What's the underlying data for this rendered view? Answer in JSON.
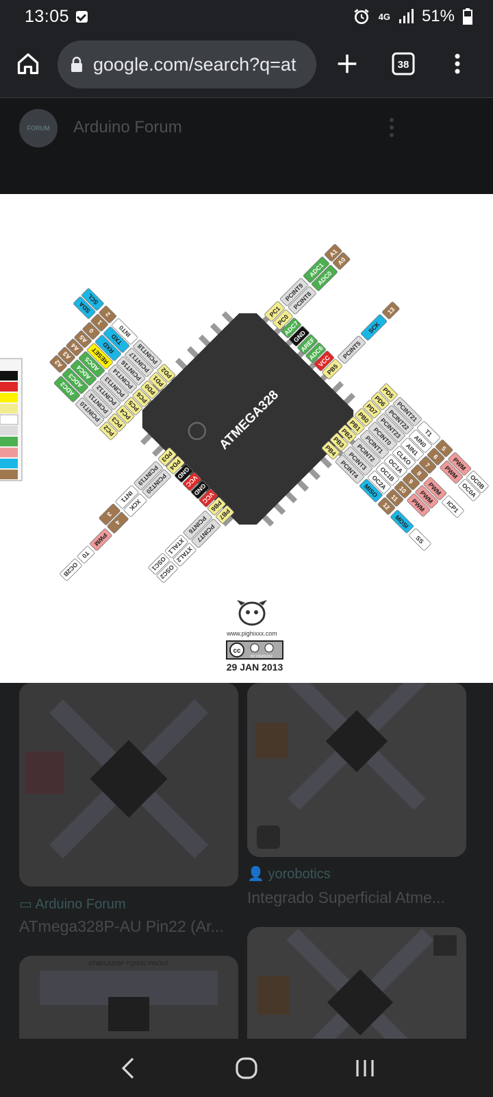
{
  "status_bar": {
    "time": "13:05",
    "network": "4G",
    "battery": "51%"
  },
  "browser": {
    "url": "google.com/search?q=at",
    "tab_count": "38",
    "icons": [
      "home-icon",
      "lock-icon",
      "plus-icon",
      "tabs-icon",
      "more-vert-icon"
    ]
  },
  "viewer": {
    "source_name": "Arduino Forum",
    "avatar_text": "FORUM",
    "diagram": {
      "chip_label": "ATMEGA328",
      "site": "www.pighixxx.com",
      "license": "BY PIGHIXXX",
      "date": "29 JAN 2013",
      "pins_top_left": [
        "PD2",
        "PD1",
        "PD0",
        "PC6",
        "PC5",
        "PC4",
        "PC3",
        "PC2"
      ],
      "labels_top_left_1": [
        "PCINT18",
        "PCINT17",
        "PCINT16",
        "PCINT14",
        "PCINT13",
        "PCINT12",
        "PCINT11",
        "PCINT10"
      ],
      "labels_top_left_2": [
        "INT0",
        "TXD",
        "RXD",
        "RESET",
        "ADC5",
        "ADC4",
        "ADC3",
        "ADC2"
      ],
      "labels_top_left_3": [
        "2",
        "1",
        "0",
        "A5",
        "A4",
        "A3",
        "A2"
      ],
      "labels_top_left_4": [
        "SCL",
        "SDA"
      ],
      "pins_top_right": [
        "PC1",
        "PC0",
        "ADC7",
        "GND",
        "AREF",
        "ADC6",
        "VCC",
        "PB5"
      ],
      "labels_top_right_1": [
        "PCINT9",
        "PCINT8",
        "PCINT5"
      ],
      "labels_top_right_2": [
        "ADC1",
        "ADC0",
        "SCK"
      ],
      "labels_top_right_3": [
        "A1",
        "A0",
        "13"
      ],
      "pins_bottom_left": [
        "PD3",
        "PD4",
        "GND",
        "VCC",
        "GND",
        "VCC",
        "PB6",
        "PB7"
      ],
      "labels_bottom_left_1": [
        "PCINT19",
        "PCINT20",
        "PCINT6",
        "PCINT7"
      ],
      "labels_bottom_left_2": [
        "INT1",
        "XCK",
        "XTAL1",
        "XTAL2"
      ],
      "labels_bottom_left_3": [
        "3",
        "4",
        "OSC1",
        "OSC2"
      ],
      "labels_bottom_left_4": [
        "PWM",
        "T0",
        "OC2B"
      ],
      "pins_bottom_right": [
        "PB4",
        "PB3",
        "PB2",
        "PB1",
        "PB0",
        "PD7",
        "PD6",
        "PD5"
      ],
      "labels_bottom_right_1": [
        "PCINT4",
        "PCINT3",
        "PCINT2",
        "PCINT1",
        "PCINT0",
        "PCINT23",
        "PCINT22",
        "PCINT21"
      ],
      "labels_bottom_right_2": [
        "MISO",
        "OC2A",
        "OC1B",
        "OC1A",
        "CLKO",
        "AIN1",
        "AIN0",
        "T1"
      ],
      "labels_bottom_right_3": [
        "12",
        "11",
        "10",
        "9",
        "8",
        "7",
        "6",
        "5"
      ],
      "labels_bottom_right_4": [
        "MOSI",
        "PWM",
        "PWM",
        "PWM",
        "ICP1",
        "PWM",
        "PWM"
      ],
      "labels_bottom_right_5": [
        "SS",
        "OC0A",
        "OC0B"
      ]
    }
  },
  "results": [
    {
      "source": "Arduino Forum",
      "title": "ATmega328P-AU Pin22 (Ar..."
    },
    {
      "source": "yorobotics",
      "title": "Integrado Superficial Atme..."
    }
  ],
  "result_thumb_text": "ATMEGA328P-TQFP32 PINOUT",
  "colors": {
    "chip": "#333333",
    "digital_pin": "#f3ec8e",
    "pcint": "#dcdcdc",
    "analog": "#4caf50",
    "arduino_pin": "#a07850",
    "serial": "#1ab6e6",
    "power": "#e02828",
    "ground": "#111111",
    "pwm": "#ef9a9a",
    "reset": "#fff200"
  }
}
